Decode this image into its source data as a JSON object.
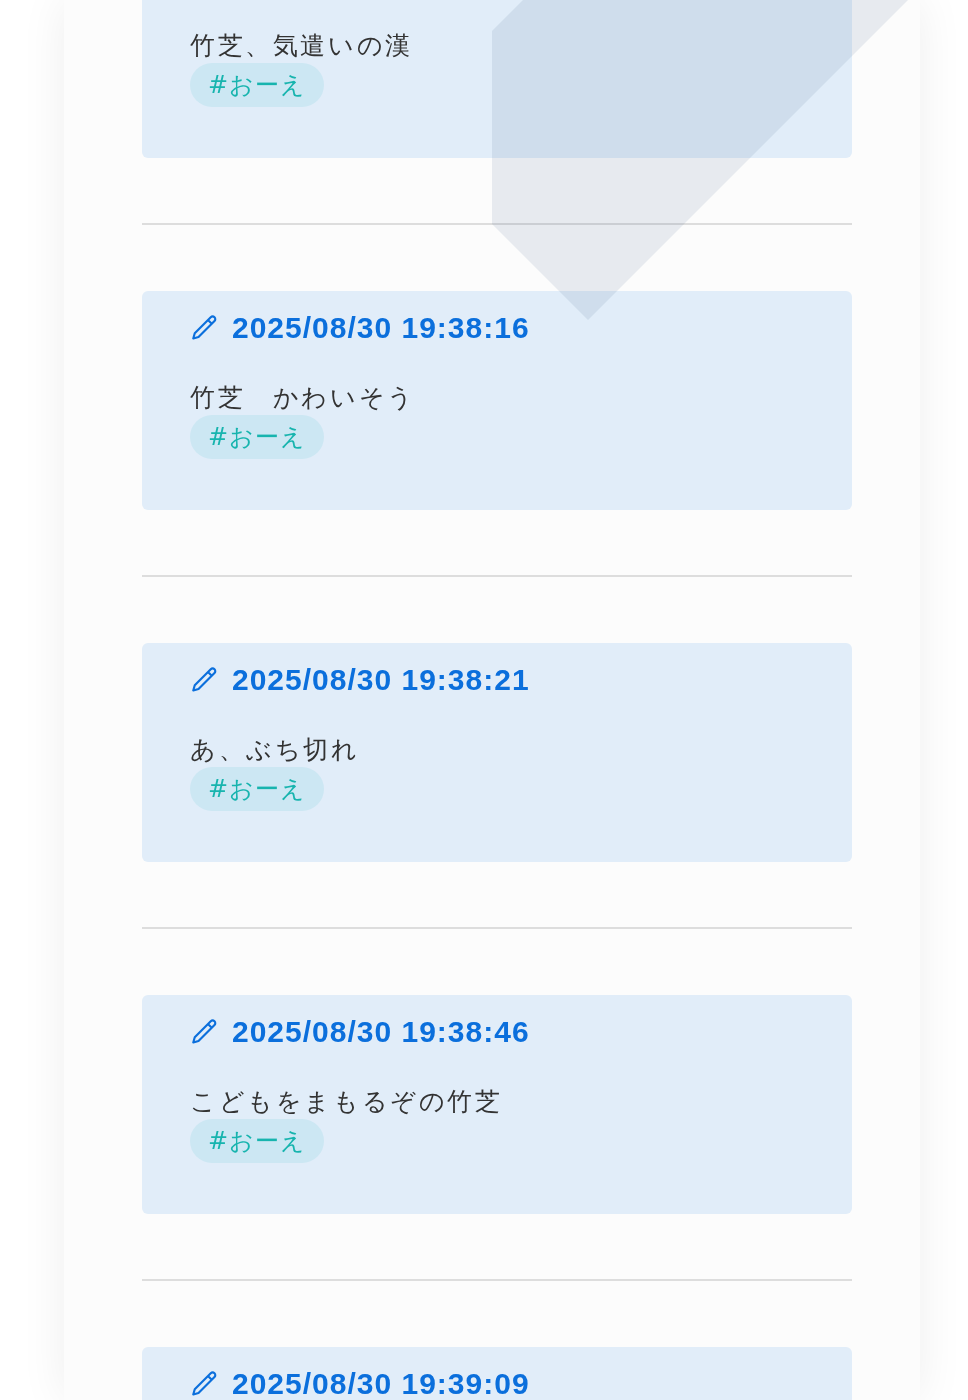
{
  "posts": [
    {
      "body": "竹芝、気遣いの漢",
      "tags": [
        "#おーえ"
      ]
    },
    {
      "timestamp": "2025/08/30 19:38:16",
      "body": "竹芝　かわいそう",
      "tags": [
        "#おーえ"
      ]
    },
    {
      "timestamp": "2025/08/30 19:38:21",
      "body": "あ、ぶち切れ",
      "tags": [
        "#おーえ"
      ]
    },
    {
      "timestamp": "2025/08/30 19:38:46",
      "body": "こどもをまもるぞの竹芝",
      "tags": [
        "#おーえ"
      ]
    },
    {
      "timestamp": "2025/08/30 19:39:09"
    }
  ]
}
